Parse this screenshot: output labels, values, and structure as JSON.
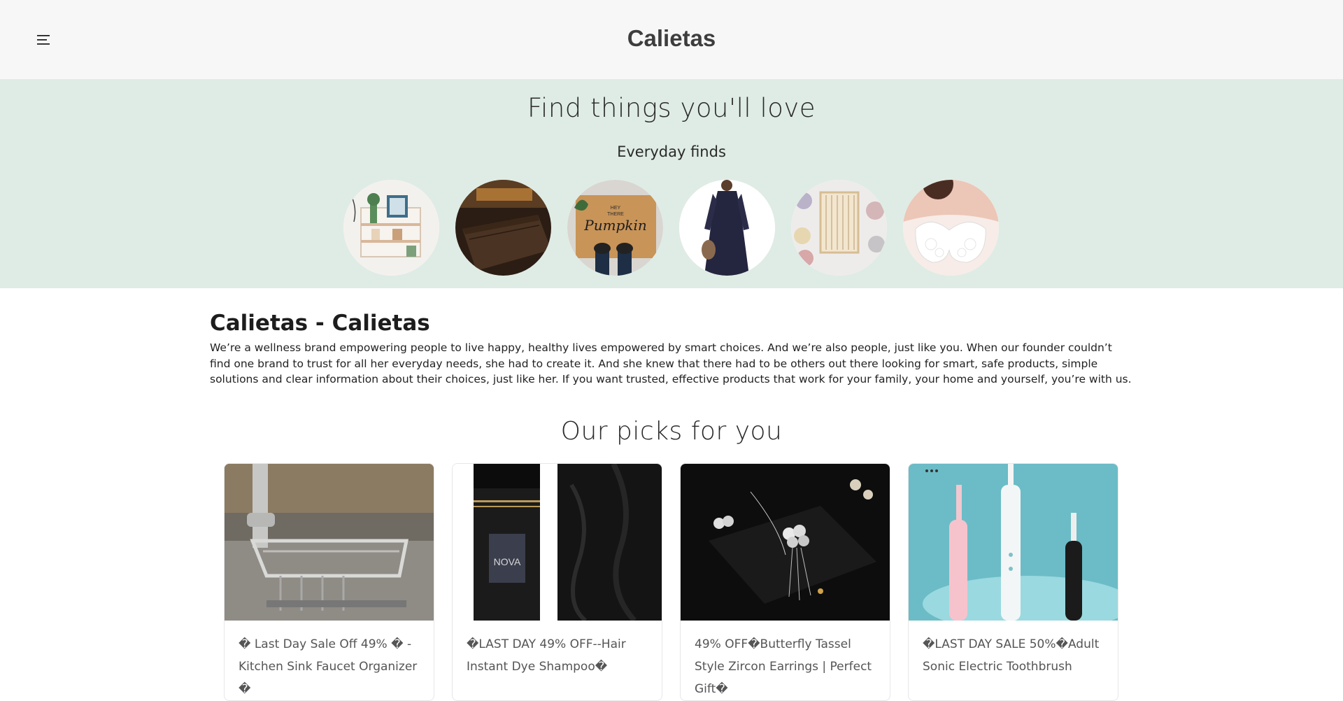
{
  "header": {
    "title": "Calietas",
    "menu_icon": "hamburger-menu-icon"
  },
  "hero": {
    "title": "Find things you'll love",
    "subtitle": "Everyday finds",
    "categories": [
      {
        "name": "wall-shelf"
      },
      {
        "name": "leather-wallet"
      },
      {
        "name": "doormat"
      },
      {
        "name": "dress"
      },
      {
        "name": "weaving-loom"
      },
      {
        "name": "lace-bra"
      }
    ]
  },
  "about": {
    "title": "Calietas - Calietas",
    "text": "We’re a wellness brand empowering people to live happy, healthy lives empowered by smart choices. And we’re also people, just like you. When our founder couldn’t find one brand to trust for all her everyday needs, she had to create it. And she knew that there had to be others out there looking for smart, safe products, simple solutions and clear information about their choices, just like her. If you want trusted, effective products that work for your family, your home and yourself, you’re with us."
  },
  "picks": {
    "title": "Our picks for you",
    "products": [
      {
        "title": "� Last Day Sale Off 49% � - Kitchen Sink Faucet Organizer �"
      },
      {
        "title": "�LAST DAY 49% OFF--Hair Instant Dye Shampoo�",
        "bottle_text": "NOVA"
      },
      {
        "title": "49% OFF�Butterfly Tassel Style Zircon Earrings | Perfect Gift�"
      },
      {
        "title": "�LAST DAY SALE 50%�Adult Sonic Electric Toothbrush"
      }
    ]
  },
  "colors": {
    "header_bg": "#f7f7f7",
    "hero_bg": "#dfece5",
    "text": "#222222"
  }
}
